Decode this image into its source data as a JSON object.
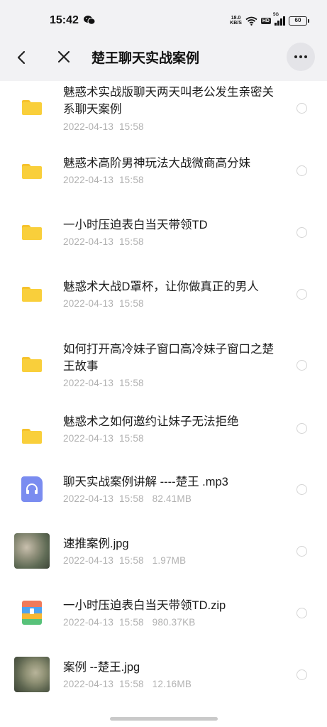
{
  "status_bar": {
    "time": "15:42",
    "net_speed_value": "18.0",
    "net_speed_unit": "KB/S",
    "hd_label": "HD",
    "signal_label": "5G",
    "battery": "60"
  },
  "header": {
    "title": "楚王聊天实战案例"
  },
  "files": [
    {
      "type": "folder",
      "name": "魅惑术实战版聊天两天叫老公发生亲密关系聊天案例",
      "date": "2022-04-13  15:58",
      "size": ""
    },
    {
      "type": "folder",
      "name": "魅惑术高阶男神玩法大战微商高分妹",
      "date": "2022-04-13  15:58",
      "size": ""
    },
    {
      "type": "folder",
      "name": "一小时压迫表白当天带领TD",
      "date": "2022-04-13  15:58",
      "size": ""
    },
    {
      "type": "folder",
      "name": "魅惑术大战D罩杯，让你做真正的男人",
      "date": "2022-04-13  15:58",
      "size": ""
    },
    {
      "type": "folder",
      "name": "如何打开高冷妹子窗口高冷妹子窗口之楚王故事",
      "date": "2022-04-13  15:58",
      "size": ""
    },
    {
      "type": "folder",
      "name": "魅惑术之如何邀约让妹子无法拒绝",
      "date": "2022-04-13  15:58",
      "size": ""
    },
    {
      "type": "audio",
      "name": "聊天实战案例讲解  ----楚王  .mp3",
      "date": "2022-04-13  15:58",
      "size": "82.41MB"
    },
    {
      "type": "image",
      "name": "速推案例.jpg",
      "date": "2022-04-13  15:58",
      "size": "1.97MB"
    },
    {
      "type": "zip",
      "name": "一小时压迫表白当天带领TD.zip",
      "date": "2022-04-13  15:58",
      "size": "980.37KB"
    },
    {
      "type": "image",
      "name": "案例  --楚王.jpg",
      "date": "2022-04-13  15:58",
      "size": "12.16MB"
    }
  ]
}
